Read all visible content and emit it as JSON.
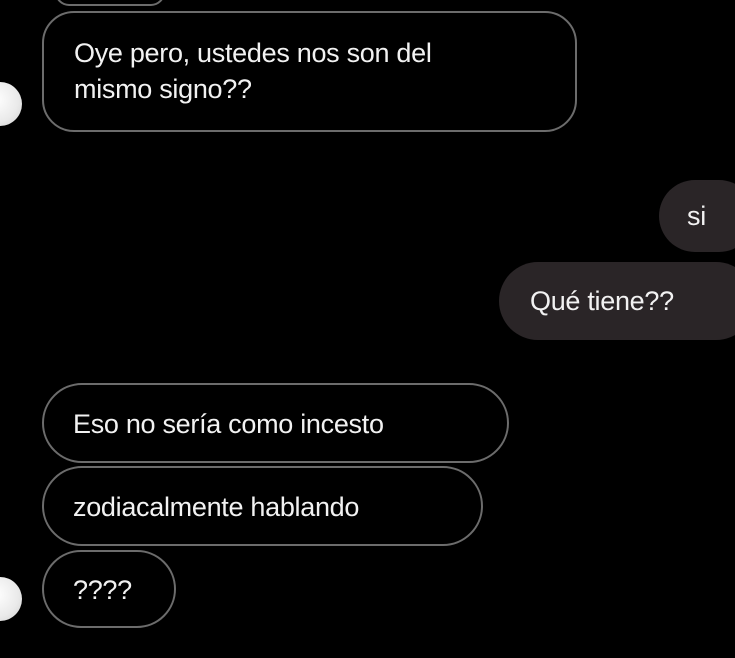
{
  "conversation": {
    "messages": [
      {
        "direction": "incoming",
        "text_line1": "Oye pero, ustedes nos son del",
        "text_line2": "mismo signo??"
      },
      {
        "direction": "outgoing",
        "text": "si"
      },
      {
        "direction": "outgoing",
        "text": "Qué tiene??"
      },
      {
        "direction": "incoming",
        "text": "Eso no sería como incesto"
      },
      {
        "direction": "incoming",
        "text": "zodiacalmente hablando"
      },
      {
        "direction": "incoming",
        "text": "????"
      }
    ]
  },
  "colors": {
    "background": "#000000",
    "incoming_border": "#6c6c6c",
    "outgoing_fill": "#2a2527",
    "text": "#f2f2f2"
  }
}
